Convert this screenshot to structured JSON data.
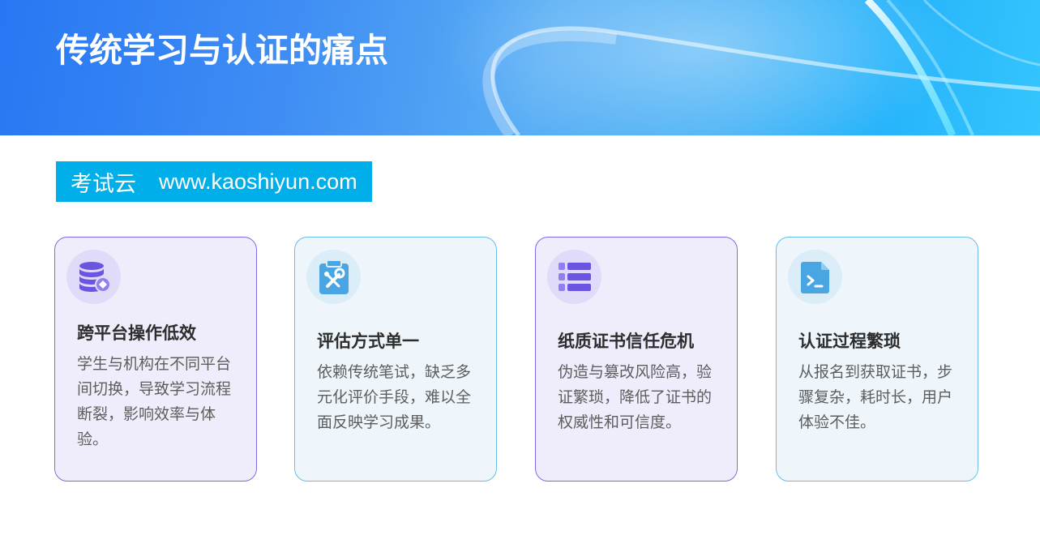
{
  "header": {
    "title": "传统学习与认证的痛点"
  },
  "brand": {
    "name": "考试云",
    "url": "www.kaoshiyun.com"
  },
  "cards": [
    {
      "icon": "database-icon",
      "title": "跨平台操作低效",
      "text": "学生与机构在不同平台间切换，导致学习流程断裂，影响效率与体验。"
    },
    {
      "icon": "clipboard-tools-icon",
      "title": "评估方式单一",
      "text": "依赖传统笔试，缺乏多元化评价手段，难以全面反映学习成果。"
    },
    {
      "icon": "list-icon",
      "title": "纸质证书信任危机",
      "text": "伪造与篡改风险高，验证繁琐，降低了证书的权威性和可信度。"
    },
    {
      "icon": "terminal-file-icon",
      "title": "认证过程繁琐",
      "text": "从报名到获取证书，步骤复杂，耗时长，用户体验不佳。"
    }
  ],
  "colors": {
    "brand_bg": "#00aeea",
    "card_purple_border": "#8069e6",
    "card_blue_border": "#6bbde6",
    "icon_purple": "#6a55e3",
    "icon_blue": "#4aa6e3"
  }
}
